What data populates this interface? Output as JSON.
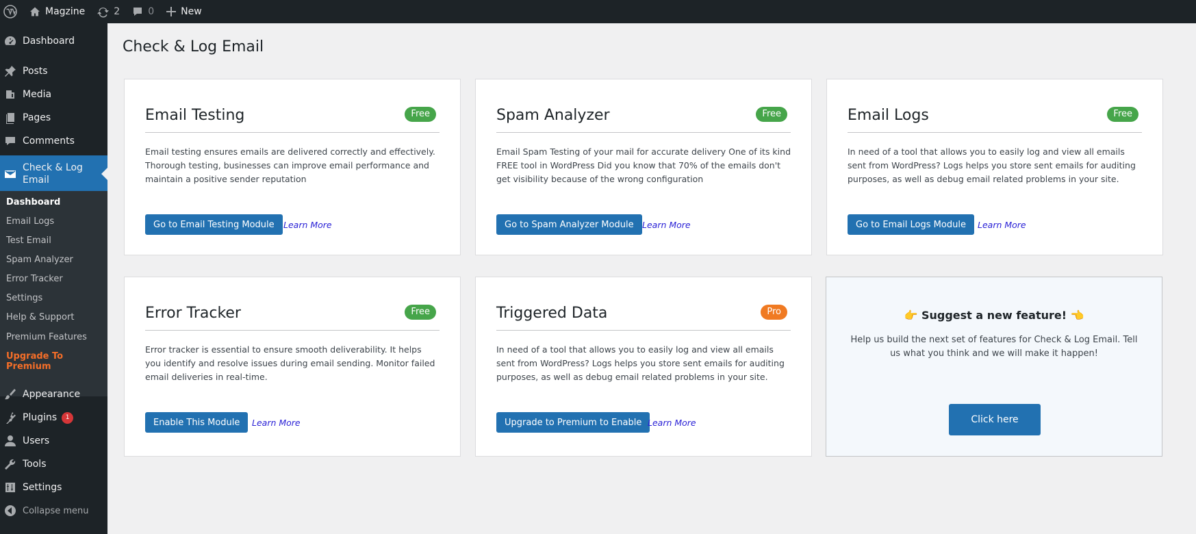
{
  "adminbar": {
    "site_name": "Magzine",
    "updates_count": "2",
    "comments_count": "0",
    "new_label": "New"
  },
  "sidebar": {
    "dashboard": "Dashboard",
    "posts": "Posts",
    "media": "Media",
    "pages": "Pages",
    "comments": "Comments",
    "check_log_email": "Check & Log Email",
    "submenu": {
      "dashboard": "Dashboard",
      "email_logs": "Email Logs",
      "test_email": "Test Email",
      "spam_analyzer": "Spam Analyzer",
      "error_tracker": "Error Tracker",
      "settings": "Settings",
      "help_support": "Help & Support",
      "premium_features": "Premium Features",
      "upgrade": "Upgrade To Premium"
    },
    "appearance": "Appearance",
    "plugins": "Plugins",
    "plugins_badge": "1",
    "users": "Users",
    "tools": "Tools",
    "settings": "Settings",
    "collapse": "Collapse menu"
  },
  "page": {
    "title": "Check & Log Email"
  },
  "cards": [
    {
      "title": "Email Testing",
      "tag": "Free",
      "desc": "Email testing ensures emails are delivered correctly and effectively. Thorough testing, businesses can improve email performance and maintain a positive sender reputation",
      "button": "Go to Email Testing Module",
      "learn": "Learn More"
    },
    {
      "title": "Spam Analyzer",
      "tag": "Free",
      "desc": "Email Spam Testing of your mail for accurate delivery One of its kind FREE tool in WordPress Did you know that 70% of the emails don't get visibility because of the wrong configuration",
      "button": "Go to Spam Analyzer Module",
      "learn": "Learn More"
    },
    {
      "title": "Email Logs",
      "tag": "Free",
      "desc": "In need of a tool that allows you to easily log and view all emails sent from WordPress? Logs helps you store sent emails for auditing purposes, as well as debug email related problems in your site.",
      "button": "Go to Email Logs Module",
      "learn": "Learn More"
    },
    {
      "title": "Error Tracker",
      "tag": "Free",
      "desc": "Error tracker is essential to ensure smooth deliverability. It helps you identify and resolve issues during email sending. Monitor failed email deliveries in real-time.",
      "button": "Enable This Module",
      "learn": "Learn More"
    },
    {
      "title": "Triggered Data",
      "tag": "Pro",
      "desc": "In need of a tool that allows you to easily log and view all emails sent from WordPress? Logs helps you store sent emails for auditing purposes, as well as debug email related problems in your site.",
      "button": "Upgrade to Premium to Enable",
      "learn": "Learn More"
    }
  ],
  "suggest": {
    "title": "👉 Suggest a new feature! 👈",
    "desc": "Help us build the next set of features for Check & Log Email. Tell us what you think and we will make it happen!",
    "button": "Click here"
  },
  "colors": {
    "admin_dark": "#1d2327",
    "submenu_bg": "#2c3338",
    "accent_blue": "#2271b1",
    "free_green": "#46a54a",
    "pro_orange": "#f07a22",
    "upgrade_orange": "#f56e28",
    "learn_link": "#2a21d6"
  }
}
